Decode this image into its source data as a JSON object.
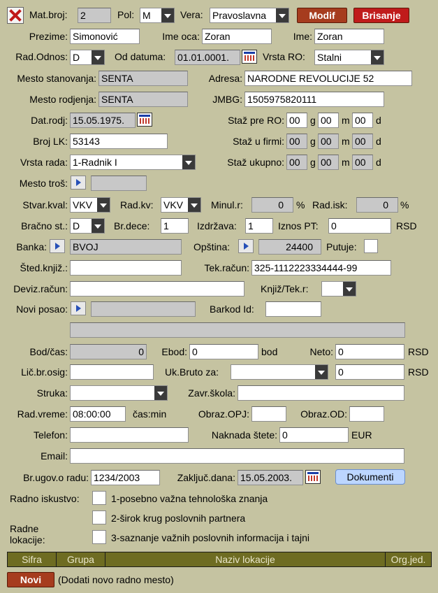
{
  "row1": {
    "mat_broj_label": "Mat.broj:",
    "mat_broj": "2",
    "pol_label": "Pol:",
    "pol": "M",
    "vera_label": "Vera:",
    "vera": "Pravoslavna",
    "modif": "Modif",
    "brisanje": "Brisanje"
  },
  "row2": {
    "prezime_label": "Prezime:",
    "prezime": "Simonović",
    "ime_oca_label": "Ime oca:",
    "ime_oca": "Zoran",
    "ime_label": "Ime:",
    "ime": "Zoran"
  },
  "row3": {
    "rad_odnos_label": "Rad.Odnos:",
    "rad_odnos": "D",
    "od_datuma_label": "Od datuma:",
    "od_datuma": "01.01.0001.",
    "vrsta_ro_label": "Vrsta RO:",
    "vrsta_ro": "Stalni"
  },
  "row4": {
    "mesto_stanovanja_label": "Mesto stanovanja:",
    "mesto_stanovanja": "SENTA",
    "adresa_label": "Adresa:",
    "adresa": "NARODNE REVOLUCIJE 52"
  },
  "row5": {
    "mesto_rodjenja_label": "Mesto rodjenja:",
    "mesto_rodjenja": "SENTA",
    "jmbg_label": "JMBG:",
    "jmbg": "1505975820111"
  },
  "row6": {
    "dat_rodj_label": "Dat.rodj:",
    "dat_rodj": "15.05.1975.",
    "staz_pre_label": "Staž pre RO:",
    "staz_pre_g": "00",
    "staz_pre_m": "00",
    "staz_pre_d": "00"
  },
  "row7": {
    "broj_lk_label": "Broj LK:",
    "broj_lk": "53143",
    "staz_firmi_label": "Staž u firmi:",
    "staz_firmi_g": "00",
    "staz_firmi_m": "00",
    "staz_firmi_d": "00"
  },
  "row8": {
    "vrsta_rada_label": "Vrsta rada:",
    "vrsta_rada": "1-Radnik I",
    "staz_ukupno_label": "Staž ukupno:",
    "staz_uk_g": "00",
    "staz_uk_m": "00",
    "staz_uk_d": "00"
  },
  "units": {
    "g": "g",
    "m": "m",
    "d": "d",
    "pct": "%",
    "rsd": "RSD",
    "bod": "bod",
    "eur": "EUR",
    "cas_min": "čas:min"
  },
  "row9": {
    "mesto_tros_label": "Mesto troš:",
    "mesto_tros": ""
  },
  "row10": {
    "stvar_kval_label": "Stvar.kval:",
    "stvar_kval": "VKV",
    "rad_kv_label": "Rad.kv:",
    "rad_kv": "VKV",
    "minul_label": "Minul.r:",
    "minul": "0",
    "rad_isk_label": "Rad.isk:",
    "rad_isk": "0"
  },
  "row11": {
    "bracno_label": "Bračno st.:",
    "bracno": "D",
    "br_dece_label": "Br.dece:",
    "br_dece": "1",
    "izdrzava_label": "Izdržava:",
    "izdrzava": "1",
    "iznos_pt_label": "Iznos PT:",
    "iznos_pt": "0"
  },
  "row12": {
    "banka_label": "Banka:",
    "banka": "BVOJ",
    "opstina_label": "Opština:",
    "opstina": "24400",
    "putuje_label": "Putuje:"
  },
  "row13": {
    "sted_label": "Šted.knjiž.:",
    "sted": "",
    "tek_racun_label": "Tek.račun:",
    "tek_racun": "325-1112223334444-99"
  },
  "row14": {
    "deviz_label": "Deviz.račun:",
    "deviz": "",
    "knjiz_label": "Knjiž/Tek.r:",
    "knjiz": ""
  },
  "row15": {
    "novi_posao_label": "Novi posao:",
    "novi_posao": "",
    "barkod_label": "Barkod Id:",
    "barkod": ""
  },
  "row17": {
    "bod_cas_label": "Bod/čas:",
    "bod_cas": "0",
    "ebod_label": "Ebod:",
    "ebod": "0",
    "neto_label": "Neto:",
    "neto": "0"
  },
  "row18": {
    "lic_br_label": "Lič.br.osig:",
    "lic_br": "",
    "uk_bruto_label": "Uk.Bruto za:",
    "uk_bruto_sel": "",
    "uk_bruto": "0"
  },
  "row19": {
    "struka_label": "Struka:",
    "struka": "",
    "zavr_skola_label": "Zavr.škola:",
    "zavr_skola": ""
  },
  "row20": {
    "rad_vreme_label": "Rad.vreme:",
    "rad_vreme": "08:00:00",
    "obraz_opj_label": "Obraz.OPJ:",
    "obraz_od_label": "Obraz.OD:"
  },
  "row21": {
    "telefon_label": "Telefon:",
    "telefon": "",
    "naknada_label": "Naknada štete:",
    "naknada": "0"
  },
  "row22": {
    "email_label": "Email:",
    "email": ""
  },
  "row23": {
    "br_ugov_label": "Br.ugov.o radu:",
    "br_ugov": "1234/2003",
    "zakljuc_label": "Zaključ.dana:",
    "zakljuc": "15.05.2003.",
    "dokumenti": "Dokumenti"
  },
  "iskustvo": {
    "label": "Radno iskustvo:",
    "opt1": "1-posebno važna tehnološka znanja",
    "opt2": "2-širok krug poslovnih partnera",
    "opt3": "3-saznanje važnih poslovnih informacija i tajni",
    "lokacije_label1": "Radne",
    "lokacije_label2": "lokacije:"
  },
  "table": {
    "headers": [
      "Sifra",
      "Grupa",
      "Naziv lokacije",
      "Org.jed."
    ]
  },
  "footer": {
    "novi": "Novi",
    "note": "(Dodati novo radno mesto)"
  }
}
